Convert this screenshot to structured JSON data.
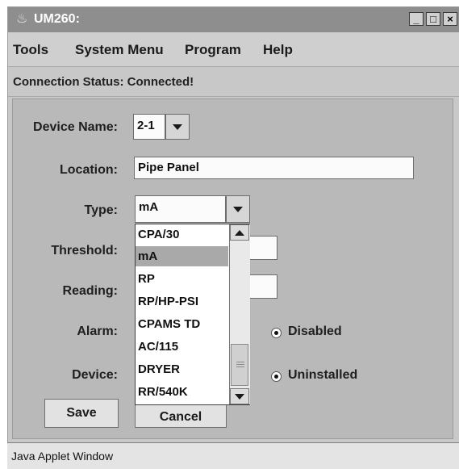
{
  "window": {
    "title": "UM260:",
    "icon": "java-cup-icon"
  },
  "menu": [
    "Tools",
    "System Menu",
    "Program",
    "Help"
  ],
  "status": "Connection Status: Connected!",
  "form": {
    "device_name_label": "Device Name:",
    "device_name_value": "2-1",
    "location_label": "Location:",
    "location_value": "Pipe Panel",
    "type_label": "Type:",
    "type_value": "mA",
    "threshold_label": "Threshold:",
    "reading_label": "Reading:",
    "alarm_label": "Alarm:",
    "alarm_option": "Disabled",
    "device_label": "Device:",
    "device_option": "Uninstalled"
  },
  "dropdown": {
    "items": [
      "CPA/30",
      "mA",
      "RP",
      "RP/HP-PSI",
      "CPAMS TD",
      "AC/115",
      "DRYER",
      "RR/540K"
    ],
    "selected": "mA"
  },
  "buttons": {
    "save": "Save",
    "cancel": "Cancel"
  },
  "footer": "Java Applet Window"
}
